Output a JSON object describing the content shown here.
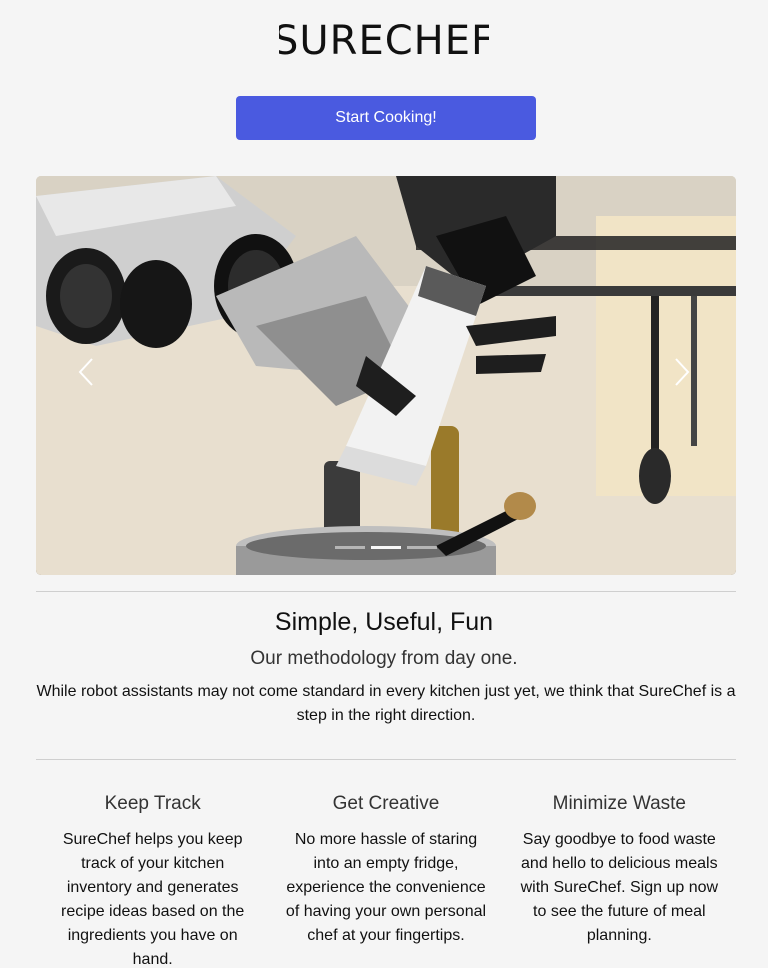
{
  "brand": {
    "logo_text": "SURECHEF"
  },
  "cta": {
    "label": "Start Cooking!",
    "color": "#4a5ae0"
  },
  "carousel": {
    "image_alt": "Robotic arms cooking in a kitchen",
    "prev_icon": "chevron-left-icon",
    "next_icon": "chevron-right-icon",
    "slide_count": 3,
    "active_index": 1
  },
  "intro": {
    "title": "Simple, Useful, Fun",
    "subtitle": "Our methodology from day one.",
    "text": "While robot assistants may not come standard in every kitchen just yet, we think that SureChef is a step in the right direction."
  },
  "features": [
    {
      "title": "Keep Track",
      "text": "SureChef helps you keep track of your kitchen inventory and generates recipe ideas based on the ingredients you have on hand."
    },
    {
      "title": "Get Creative",
      "text": "No more hassle of staring into an empty fridge, experience the convenience of having your own personal chef at your fingertips."
    },
    {
      "title": "Minimize Waste",
      "text": "Say goodbye to food waste and hello to delicious meals with SureChef. Sign up now to see the future of meal planning."
    }
  ]
}
